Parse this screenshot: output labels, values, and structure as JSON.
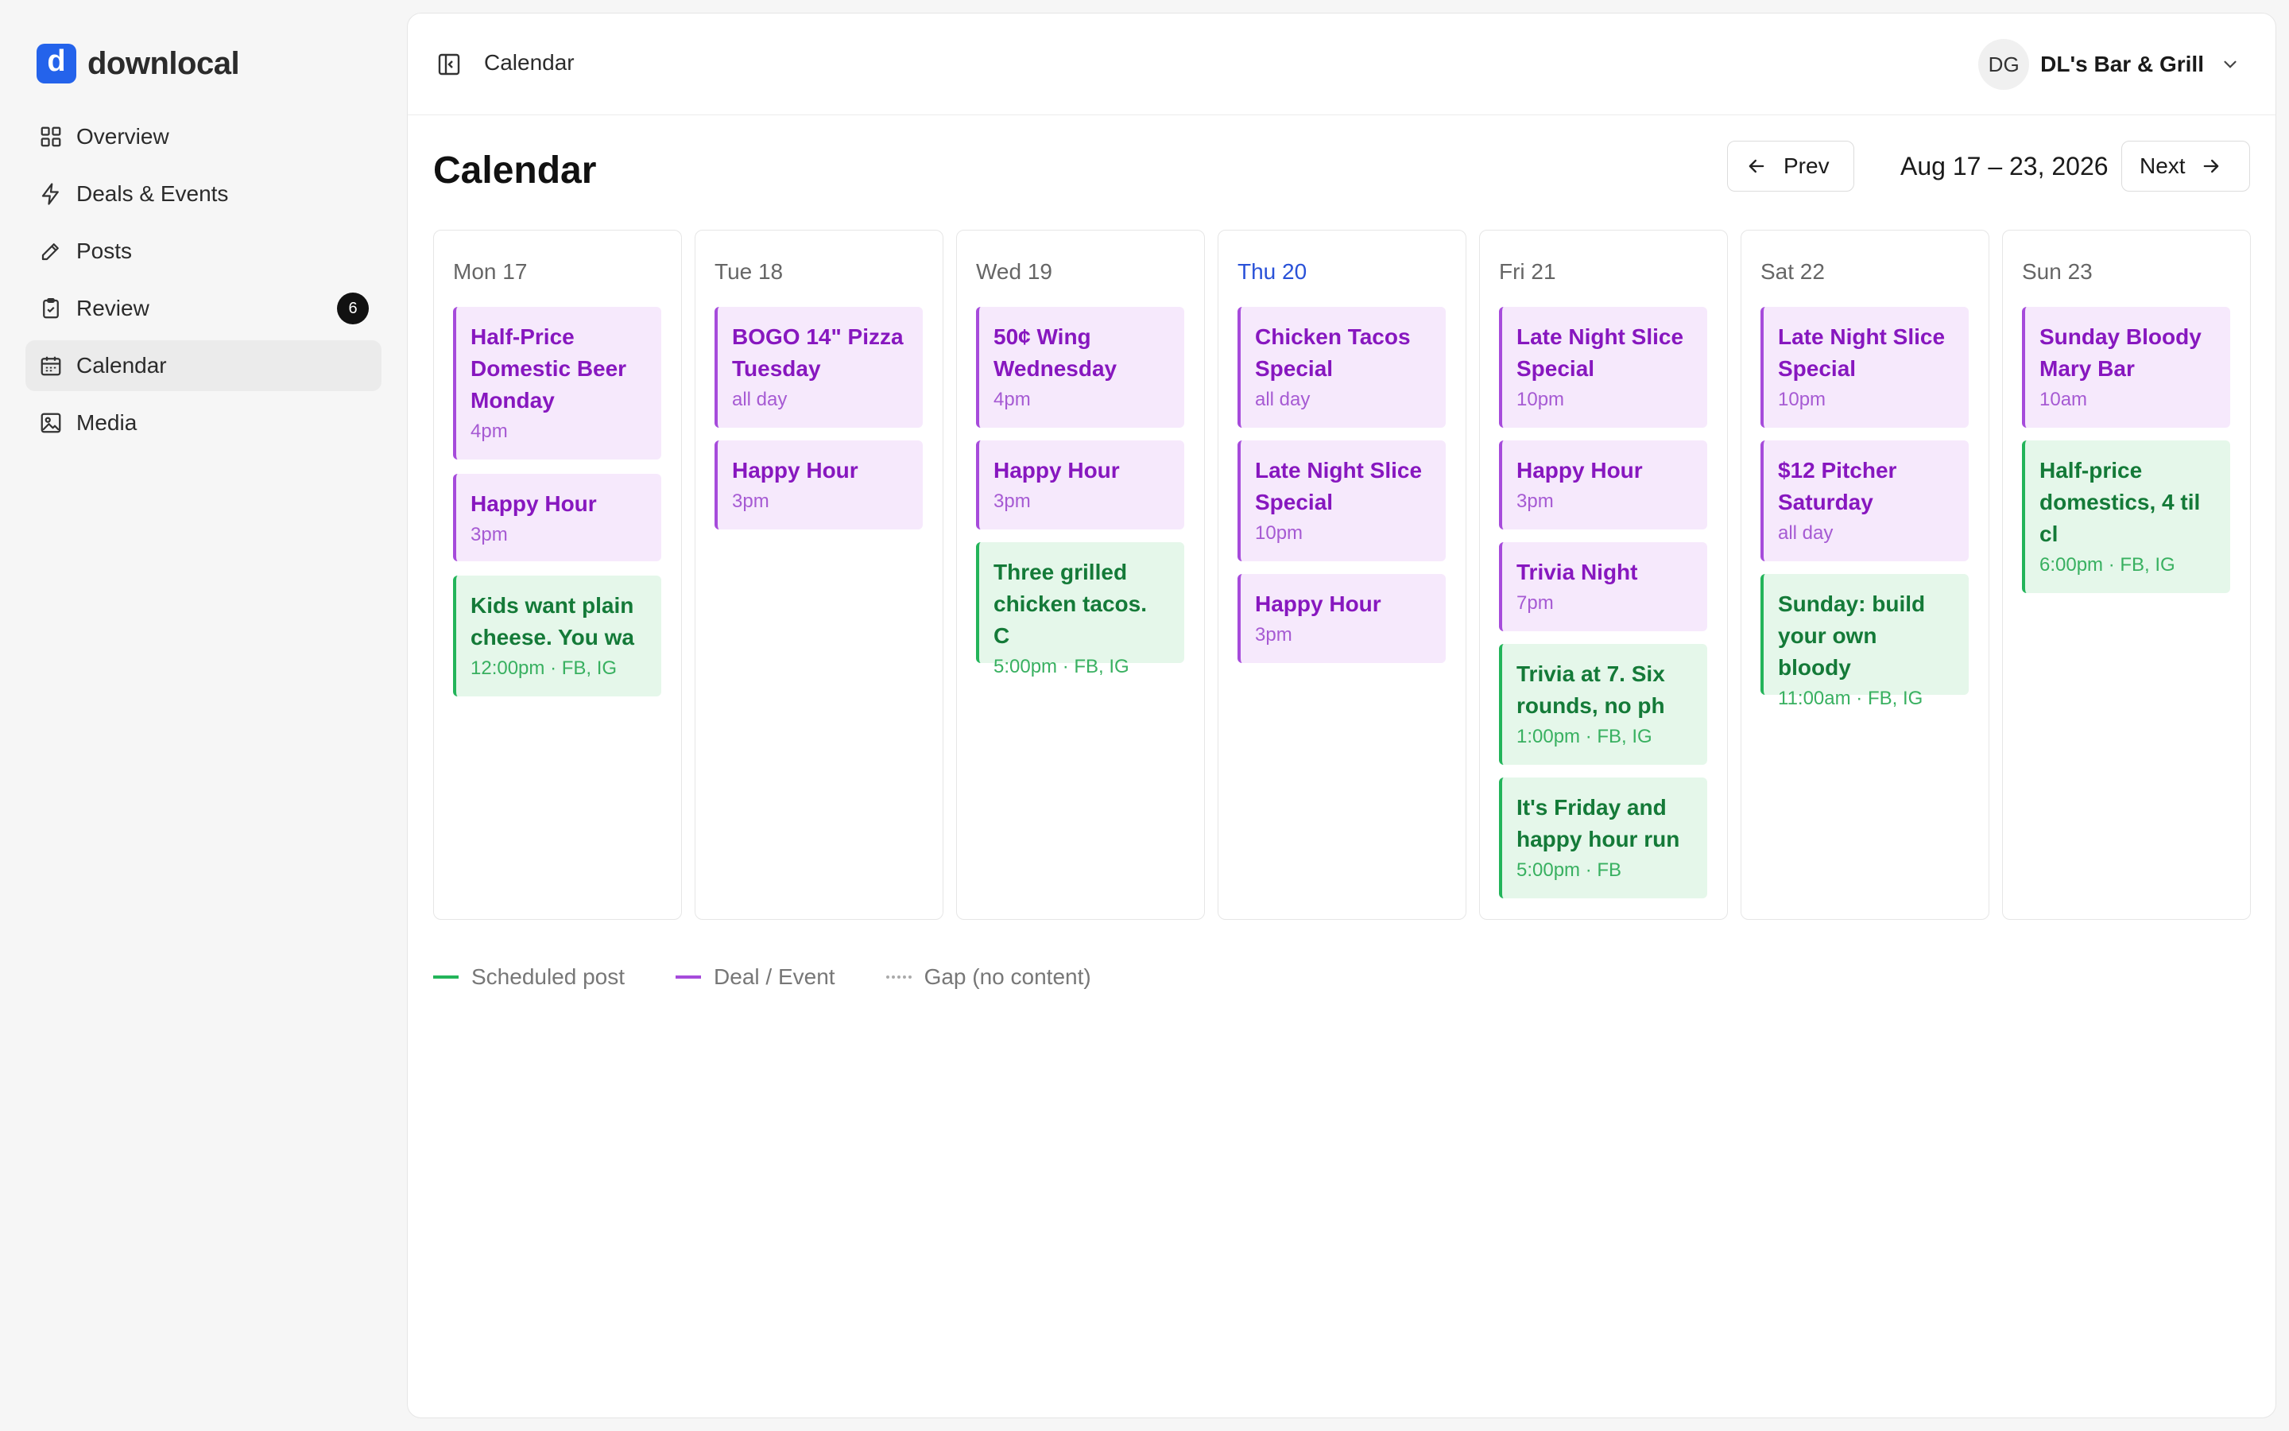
{
  "brand": {
    "logo_letter": "d",
    "name": "downlocal",
    "color": "#2463eb"
  },
  "sidebar": {
    "items": [
      {
        "label": "Overview",
        "icon": "grid-icon"
      },
      {
        "label": "Deals & Events",
        "icon": "bolt-icon"
      },
      {
        "label": "Posts",
        "icon": "pencil-icon"
      },
      {
        "label": "Review",
        "icon": "clipboard-check-icon",
        "badge": "6"
      },
      {
        "label": "Calendar",
        "icon": "calendar-icon",
        "active": true
      },
      {
        "label": "Media",
        "icon": "image-icon"
      }
    ]
  },
  "topbar": {
    "title": "Calendar",
    "account": {
      "initials": "DG",
      "name": "DL's Bar & Grill"
    }
  },
  "page": {
    "title": "Calendar",
    "prev_label": "Prev",
    "next_label": "Next",
    "date_range": "Aug 17 – 23, 2026"
  },
  "colors": {
    "deal_accent": "#a64bdb",
    "deal_bg": "#f6e9fc",
    "post_accent": "#23b45a",
    "post_bg": "#e5f7ea",
    "today": "#2a52d8"
  },
  "days": [
    {
      "label": "Mon 17",
      "events": [
        {
          "type": "deal",
          "title": "Half-Price Domestic Beer Monday",
          "meta": "4pm"
        },
        {
          "type": "deal",
          "title": "Happy Hour",
          "meta": "3pm"
        },
        {
          "type": "post",
          "title": "Kids want plain cheese. You wa",
          "meta": "12:00pm · FB, IG"
        }
      ]
    },
    {
      "label": "Tue 18",
      "events": [
        {
          "type": "deal",
          "title": "BOGO 14\" Pizza Tuesday",
          "meta": "all day"
        },
        {
          "type": "deal",
          "title": "Happy Hour",
          "meta": "3pm"
        }
      ]
    },
    {
      "label": "Wed 19",
      "events": [
        {
          "type": "deal",
          "title": "50¢ Wing Wednesday",
          "meta": "4pm"
        },
        {
          "type": "deal",
          "title": "Happy Hour",
          "meta": "3pm"
        },
        {
          "type": "post",
          "title": "Three grilled chicken tacos. C",
          "meta": "5:00pm · FB, IG"
        }
      ]
    },
    {
      "label": "Thu 20",
      "today": true,
      "events": [
        {
          "type": "deal",
          "title": "Chicken Tacos Special",
          "meta": "all day"
        },
        {
          "type": "deal",
          "title": "Late Night Slice Special",
          "meta": "10pm"
        },
        {
          "type": "deal",
          "title": "Happy Hour",
          "meta": "3pm"
        }
      ]
    },
    {
      "label": "Fri 21",
      "events": [
        {
          "type": "deal",
          "title": "Late Night Slice Special",
          "meta": "10pm"
        },
        {
          "type": "deal",
          "title": "Happy Hour",
          "meta": "3pm"
        },
        {
          "type": "deal",
          "title": "Trivia Night",
          "meta": "7pm"
        },
        {
          "type": "post",
          "title": "Trivia at 7. Six rounds, no ph",
          "meta": "1:00pm · FB, IG"
        },
        {
          "type": "post",
          "title": "It's Friday and happy hour run",
          "meta": "5:00pm · FB"
        }
      ]
    },
    {
      "label": "Sat 22",
      "events": [
        {
          "type": "deal",
          "title": "Late Night Slice Special",
          "meta": "10pm"
        },
        {
          "type": "deal",
          "title": "$12 Pitcher Saturday",
          "meta": "all day"
        },
        {
          "type": "post",
          "title": "Sunday: build your own bloody",
          "meta": "11:00am · FB, IG"
        }
      ]
    },
    {
      "label": "Sun 23",
      "events": [
        {
          "type": "deal",
          "title": "Sunday Bloody Mary Bar",
          "meta": "10am"
        },
        {
          "type": "post",
          "title": "Half-price domestics, 4 til cl",
          "meta": "6:00pm · FB, IG"
        }
      ]
    }
  ],
  "legend": [
    {
      "label": "Scheduled post",
      "style": "post"
    },
    {
      "label": "Deal / Event",
      "style": "deal"
    },
    {
      "label": "Gap (no content)",
      "style": "gap"
    }
  ]
}
